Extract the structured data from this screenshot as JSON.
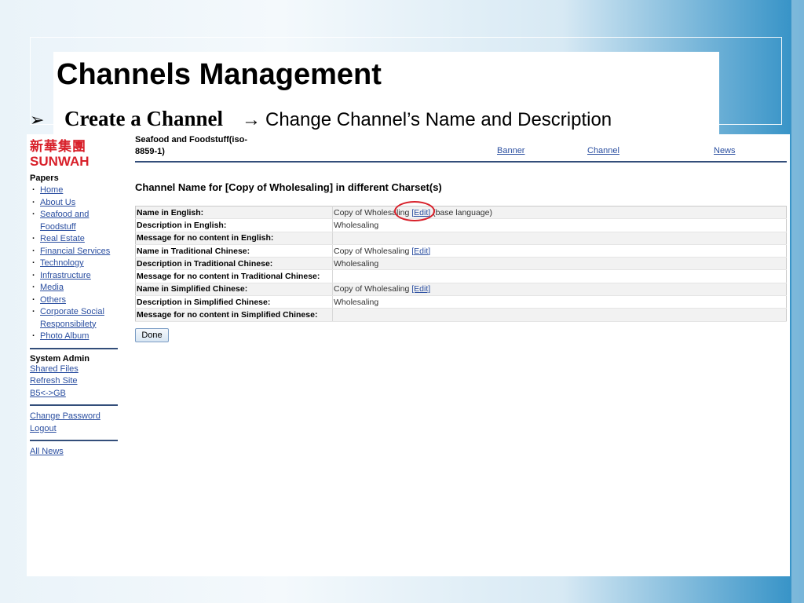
{
  "slide": {
    "title": "Channels Management",
    "bullet_main": "Create a Channel",
    "bullet_arrow": "→",
    "bullet_sub": "Change Channel’s Name and Description"
  },
  "logo": {
    "chinese": "新華集團",
    "english": "SUNWAH"
  },
  "sidebar": {
    "papers_heading": "Papers",
    "papers": [
      "Home",
      "About Us",
      "Seafood and Foodstuff",
      "Real Estate",
      "Financial Services",
      "Technology",
      "Infrastructure",
      "Media",
      "Others",
      "Corporate Social Responsibilety",
      "Photo Album"
    ],
    "system_heading": "System Admin",
    "system_links": [
      "Shared Files",
      "Refresh Site",
      "B5<->GB"
    ],
    "account_links": [
      "Change Password",
      "Logout"
    ],
    "all_news": "All News"
  },
  "header": {
    "section_name": "Seafood and Foodstuff(iso-8859-1)",
    "links": [
      "Banner",
      "Channel",
      "News"
    ]
  },
  "page_heading": "Channel Name for [Copy of Wholesaling] in different Charset(s)",
  "rows": [
    {
      "label": "Name in English:",
      "value": "Copy of Wholesaling",
      "edit": "[Edit]",
      "note": "(base language)"
    },
    {
      "label": "Description in English:",
      "value": "Wholesaling",
      "edit": "",
      "note": ""
    },
    {
      "label": "Message for no content in English:",
      "value": "",
      "edit": "",
      "note": ""
    },
    {
      "label": "Name in Traditional Chinese:",
      "value": "Copy of Wholesaling",
      "edit": "[Edit]",
      "note": ""
    },
    {
      "label": "Description in Traditional Chinese:",
      "value": "Wholesaling",
      "edit": "",
      "note": ""
    },
    {
      "label": "Message for no content in Traditional Chinese:",
      "value": "",
      "edit": "",
      "note": ""
    },
    {
      "label": "Name in Simplified Chinese:",
      "value": "Copy of Wholesaling",
      "edit": "[Edit]",
      "note": ""
    },
    {
      "label": "Description in Simplified Chinese:",
      "value": "Wholesaling",
      "edit": "",
      "note": ""
    },
    {
      "label": "Message for no content in Simplified Chinese:",
      "value": "",
      "edit": "",
      "note": ""
    }
  ],
  "done_label": "Done",
  "colors": {
    "link": "#2a4ea0",
    "rule": "#334e7a",
    "logo_red": "#d8202a",
    "highlight": "#d8202a"
  }
}
